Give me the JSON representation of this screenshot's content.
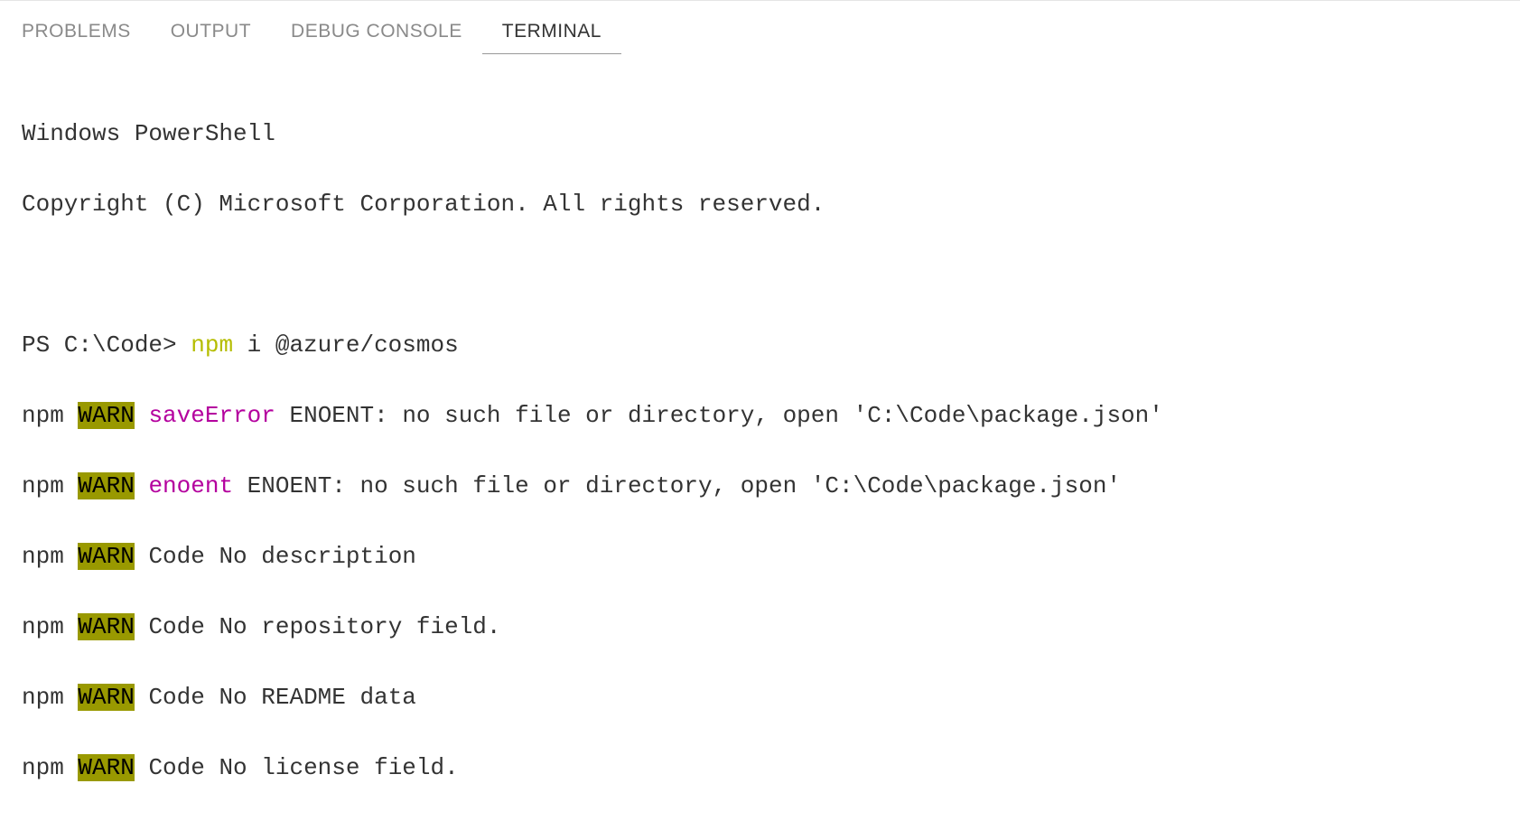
{
  "tabs": {
    "problems": "PROBLEMS",
    "output": "OUTPUT",
    "debug_console": "DEBUG CONSOLE",
    "terminal": "TERMINAL"
  },
  "terminal": {
    "header1": "Windows PowerShell",
    "header2": "Copyright (C) Microsoft Corporation. All rights reserved.",
    "prompt_prefix": "PS C:\\Code> ",
    "command_head": "npm",
    "command_rest": " i @azure/cosmos",
    "npm_prefix": "npm ",
    "warn_label": "WARN",
    "lines": [
      {
        "tag": "saveError",
        "msg": " ENOENT: no such file or directory, open 'C:\\Code\\package.json'"
      },
      {
        "tag": "enoent",
        "msg": " ENOENT: no such file or directory, open 'C:\\Code\\package.json'"
      },
      {
        "plain": " Code No description"
      },
      {
        "plain": " Code No repository field."
      },
      {
        "plain": " Code No README data"
      },
      {
        "plain": " Code No license field."
      }
    ]
  }
}
